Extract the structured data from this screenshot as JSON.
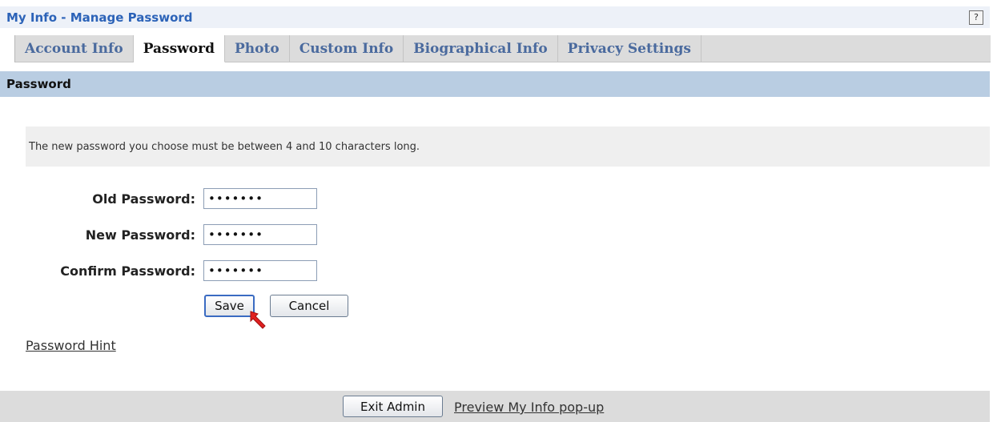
{
  "window": {
    "title": "My Info - Manage Password",
    "help_label": "?"
  },
  "tabs": [
    {
      "label": "Account Info",
      "active": false
    },
    {
      "label": "Password",
      "active": true
    },
    {
      "label": "Photo",
      "active": false
    },
    {
      "label": "Custom Info",
      "active": false
    },
    {
      "label": "Biographical Info",
      "active": false
    },
    {
      "label": "Privacy Settings",
      "active": false
    }
  ],
  "section": {
    "title": "Password"
  },
  "notice": {
    "text": "The new password you choose must be between 4 and 10 characters long."
  },
  "form": {
    "old_password": {
      "label": "Old Password:",
      "value": "•••••••"
    },
    "new_password": {
      "label": "New Password:",
      "value": "•••••••"
    },
    "confirm_password": {
      "label": "Confirm Password:",
      "value": "•••••••"
    },
    "save_label": "Save",
    "cancel_label": "Cancel"
  },
  "links": {
    "password_hint": "Password Hint"
  },
  "footer": {
    "exit_label": "Exit Admin",
    "preview_link": "Preview My Info pop-up"
  },
  "colors": {
    "title": "#2c63b8",
    "section_bg": "#b9cde2",
    "cursor": "#e02020"
  }
}
